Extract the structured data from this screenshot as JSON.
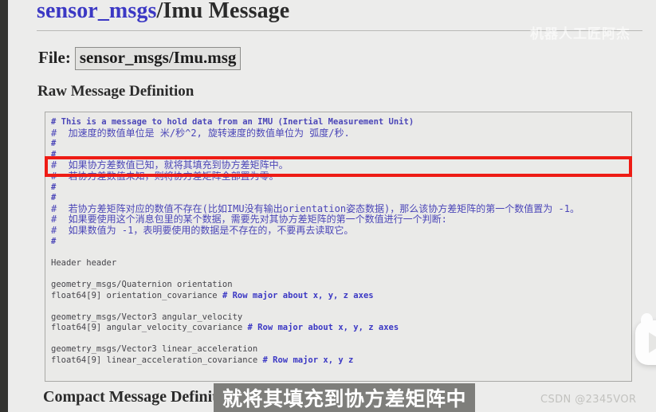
{
  "document": {
    "title_package": "sensor_msgs",
    "title_rest": "/Imu Message",
    "file_label": "File:",
    "file_value": "sensor_msgs/Imu.msg",
    "raw_heading": "Raw Message Definition",
    "compact_heading": "Compact Message Definition"
  },
  "code": {
    "lines": [
      {
        "type": "cmt",
        "text": "# This is a message to hold data from an IMU (Inertial Measurement Unit)"
      },
      {
        "type": "cn",
        "text": "#  加速度的数值单位是 米/秒^2, 旋转速度的数值单位为 弧度/秒."
      },
      {
        "type": "cmt",
        "text": "#"
      },
      {
        "type": "cmt",
        "text": "#"
      },
      {
        "type": "cn",
        "text": "#  如果协方差数值已知，就将其填充到协方差矩阵中。"
      },
      {
        "type": "cn",
        "text": "#  若协方差数值未知，则将协方差矩阵全部置为零。"
      },
      {
        "type": "cmt",
        "text": "#"
      },
      {
        "type": "cmt",
        "text": "#"
      },
      {
        "type": "cn",
        "text": "#  若协方差矩阵对应的数值不存在(比如IMU没有输出orientation姿态数据)，那么该协方差矩阵的第一个数值置为 -1。"
      },
      {
        "type": "cn",
        "text": "#  如果要使用这个消息包里的某个数据，需要先对其协方差矩阵的第一个数值进行一个判断:"
      },
      {
        "type": "cn",
        "text": "#  如果数值为 -1，表明要使用的数据是不存在的，不要再去读取它。"
      },
      {
        "type": "cmt",
        "text": "#"
      },
      {
        "type": "blank",
        "text": " "
      },
      {
        "type": "fld",
        "text": "Header header"
      },
      {
        "type": "blank",
        "text": " "
      },
      {
        "type": "fld",
        "text": "geometry_msgs/Quaternion orientation"
      },
      {
        "type": "fld",
        "text": "float64[9] orientation_covariance",
        "comment": " # Row major about x, y, z axes"
      },
      {
        "type": "blank",
        "text": " "
      },
      {
        "type": "fld",
        "text": "geometry_msgs/Vector3 angular_velocity"
      },
      {
        "type": "fld",
        "text": "float64[9] angular_velocity_covariance",
        "comment": " # Row major about x, y, z axes"
      },
      {
        "type": "blank",
        "text": " "
      },
      {
        "type": "fld",
        "text": "geometry_msgs/Vector3 linear_acceleration"
      },
      {
        "type": "fld",
        "text": "float64[9] linear_acceleration_covariance",
        "comment": " # Row major x, y z"
      }
    ]
  },
  "annotations": {
    "highlight_line_text": "#  如果协方差数值已知，就将其填充到协方差矩阵中。",
    "overlay_caption": "就将其填充到协方差矩阵中",
    "watermark_top": "机器人工匠阿杰",
    "watermark_bottom": "CSDN @2345VOR",
    "highlight_color": "#ee1c15",
    "overlay_bg": "#7e7e7b"
  }
}
